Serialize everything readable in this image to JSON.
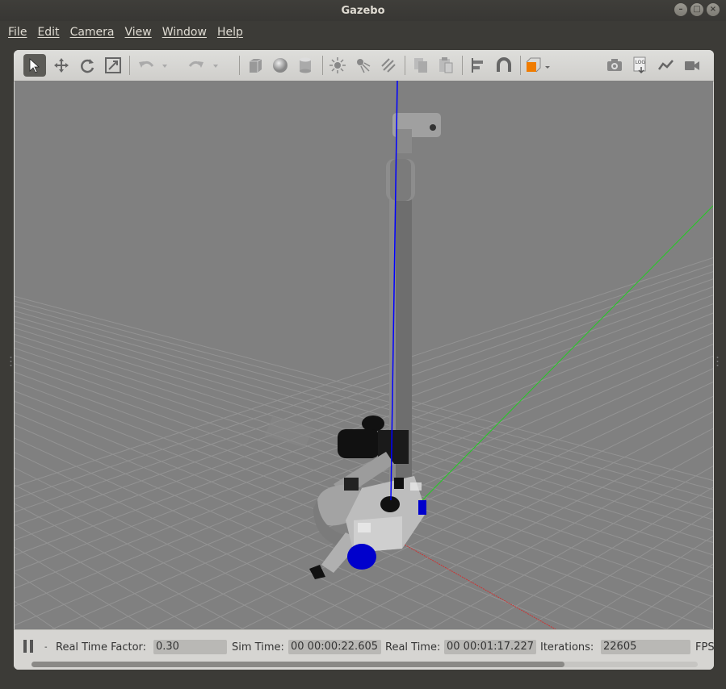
{
  "window": {
    "title": "Gazebo"
  },
  "menu": {
    "items": [
      {
        "label": "File"
      },
      {
        "label": "Edit"
      },
      {
        "label": "Camera"
      },
      {
        "label": "View"
      },
      {
        "label": "Window"
      },
      {
        "label": "Help"
      }
    ]
  },
  "toolbar": {
    "icons": [
      "select-arrow-icon",
      "translate-icon",
      "rotate-icon",
      "scale-icon",
      "undo-icon",
      "undo-dropdown-icon",
      "redo-icon",
      "redo-dropdown-icon",
      "box-icon",
      "sphere-icon",
      "cylinder-icon",
      "point-light-icon",
      "spot-light-icon",
      "directional-light-icon",
      "copy-icon",
      "paste-icon",
      "align-icon",
      "snap-icon",
      "view-angle-icon",
      "screenshot-icon",
      "log-icon",
      "plot-icon",
      "video-record-icon"
    ]
  },
  "status": {
    "pause_icon": "pause-icon",
    "real_time_factor_label": "Real Time Factor:",
    "real_time_factor_value": "0.30",
    "sim_time_label": "Sim Time:",
    "sim_time_value": "00 00:00:22.605",
    "real_time_label": "Real Time:",
    "real_time_value": "00 00:01:17.227",
    "iterations_label": "Iterations:",
    "iterations_value": "22605",
    "fps_label": "FPS"
  },
  "colors": {
    "viewport_bg": "#808080",
    "grid": "#9a9a9a",
    "z_axis": "#0000ff",
    "y_axis": "#00cc00",
    "x_axis": "#cc2222",
    "robot_gray": "#9b9b9b",
    "robot_dark": "#3a3a3a",
    "wheel_blue": "#0000cc"
  }
}
